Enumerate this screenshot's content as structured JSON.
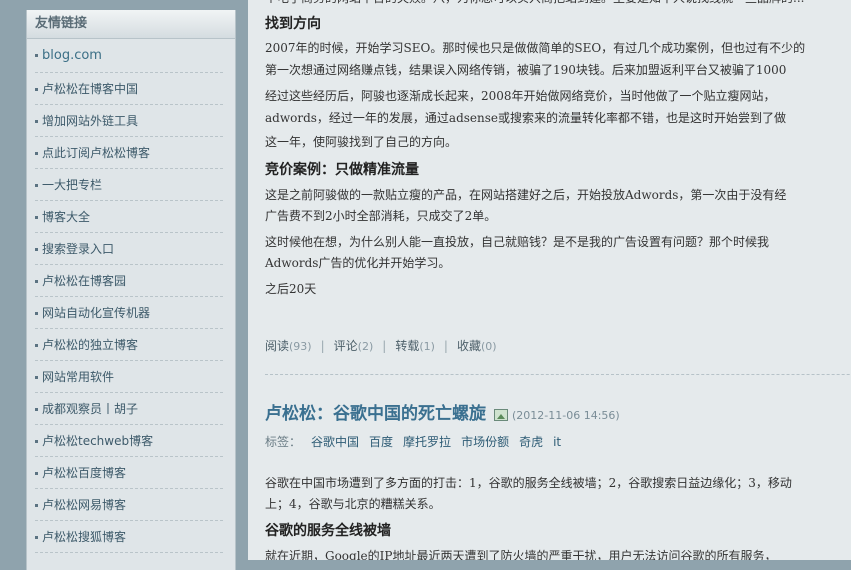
{
  "sidebar": {
    "title": "友情链接",
    "links": [
      "blog.com",
      "卢松松在博客中国",
      "增加网站外链工具",
      "点此订阅卢松松博客",
      "一大把专栏",
      "博客大全",
      "搜索登录入口",
      "卢松松在博客园",
      "网站自动化宣传机器",
      "卢松松的独立博客",
      "网站常用软件",
      "成都观察员丨胡子",
      "卢松松techweb博客",
      "卢松松百度博客",
      "卢松松网易博客",
      "卢松松搜狐博客"
    ]
  },
  "article1": {
    "top_fragment": "个电子商务的网站平台的失败。八，为你想可以实兴商把站到建。主要是知千人说找线就一些品牌的...",
    "heading1": "找到方向",
    "p1": "2007年的时候，开始学习SEO。那时候也只是做做简单的SEO，有过几个成功案例，但也过有不少的",
    "p2": "第一次想通过网络赚点钱，结果误入网络传销，被骗了190块钱。后来加盟返利平台又被骗了1000",
    "p3": "经过这些经历后，阿骏也逐渐成长起来，2008年开始做网络竞价，当时他做了一个贴立瘦网站，",
    "p4": "adwords，经过一年的发展，通过adsense或搜索来的流量转化率都不错，也是这时开始尝到了做",
    "p5": "这一年，使阿骏找到了自己的方向。",
    "heading2": "竞价案例：只做精准流量",
    "p6": "这是之前阿骏做的一款贴立瘦的产品，在网站搭建好之后，开始投放Adwords，第一次由于没有经",
    "p7": "广告费不到2小时全部消耗，只成交了2单。",
    "p8": "这时候他在想，为什么别人能一直投放，自己就赔钱？是不是我的广告设置有问题？那个时候我",
    "p9": "Adwords广告的优化并开始学习。",
    "p10": "之后20天",
    "actions": {
      "read_label": "阅读",
      "read_count": "(93)",
      "comment_label": "评论",
      "comment_count": "(2)",
      "repost_label": "转载",
      "repost_count": "(1)",
      "fav_label": "收藏",
      "fav_count": "(0)",
      "separator": "|"
    }
  },
  "article2": {
    "title": "卢松松：谷歌中国的死亡螺旋",
    "date": "(2012-11-06 14:56)",
    "tags_label": "标签：",
    "tags": [
      "谷歌中国",
      "百度",
      "摩托罗拉",
      "市场份额",
      "奇虎",
      "it"
    ],
    "p1": "谷歌在中国市场遭到了多方面的打击：1，谷歌的服务全线被墙；2，谷歌搜索日益边缘化；3，移动",
    "p2": "上；4，谷歌与北京的糟糕关系。",
    "heading1": "谷歌的服务全线被墙",
    "p3": "就在近期，Google的IP地址最近两天遭到了防火墙的严重干扰，用户无法访问谷歌的所有服务，"
  }
}
